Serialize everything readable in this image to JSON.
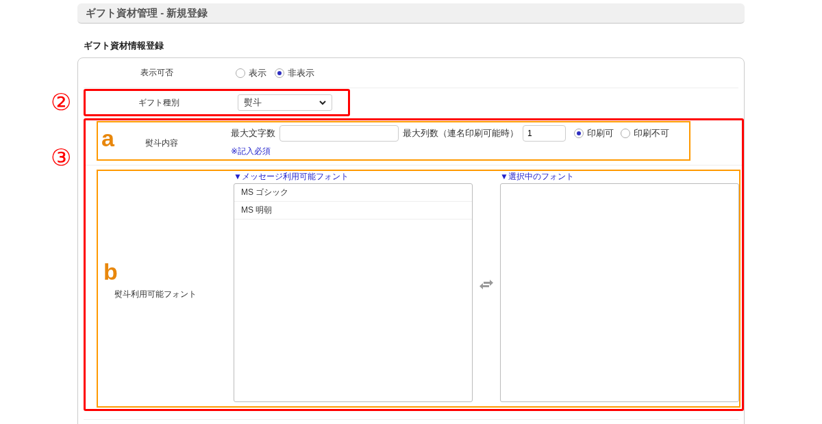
{
  "header": {
    "title": "ギフト資材管理 - 新規登録"
  },
  "section_title": "ギフト資材情報登録",
  "visibility": {
    "label": "表示可否",
    "options": [
      {
        "label": "表示",
        "selected": false
      },
      {
        "label": "非表示",
        "selected": true
      }
    ]
  },
  "gift_type": {
    "label": "ギフト種別",
    "value": "熨斗",
    "marker": "②"
  },
  "noshi": {
    "marker": "③",
    "content": {
      "marker": "a",
      "label": "熨斗内容",
      "max_chars_label": "最大文字数",
      "max_columns_label": "最大列数（連名印刷可能時）",
      "max_columns_value": "1",
      "print_options": [
        {
          "label": "印刷可",
          "selected": true
        },
        {
          "label": "印刷不可",
          "selected": false
        }
      ],
      "required_note": "※記入必須"
    },
    "fonts": {
      "marker": "b",
      "label": "熨斗利用可能フォント",
      "available_title": "▼メッセージ利用可能フォント",
      "available_items": [
        "MS ゴシック",
        "MS 明朝"
      ],
      "selected_title": "▼選択中のフォント"
    }
  }
}
